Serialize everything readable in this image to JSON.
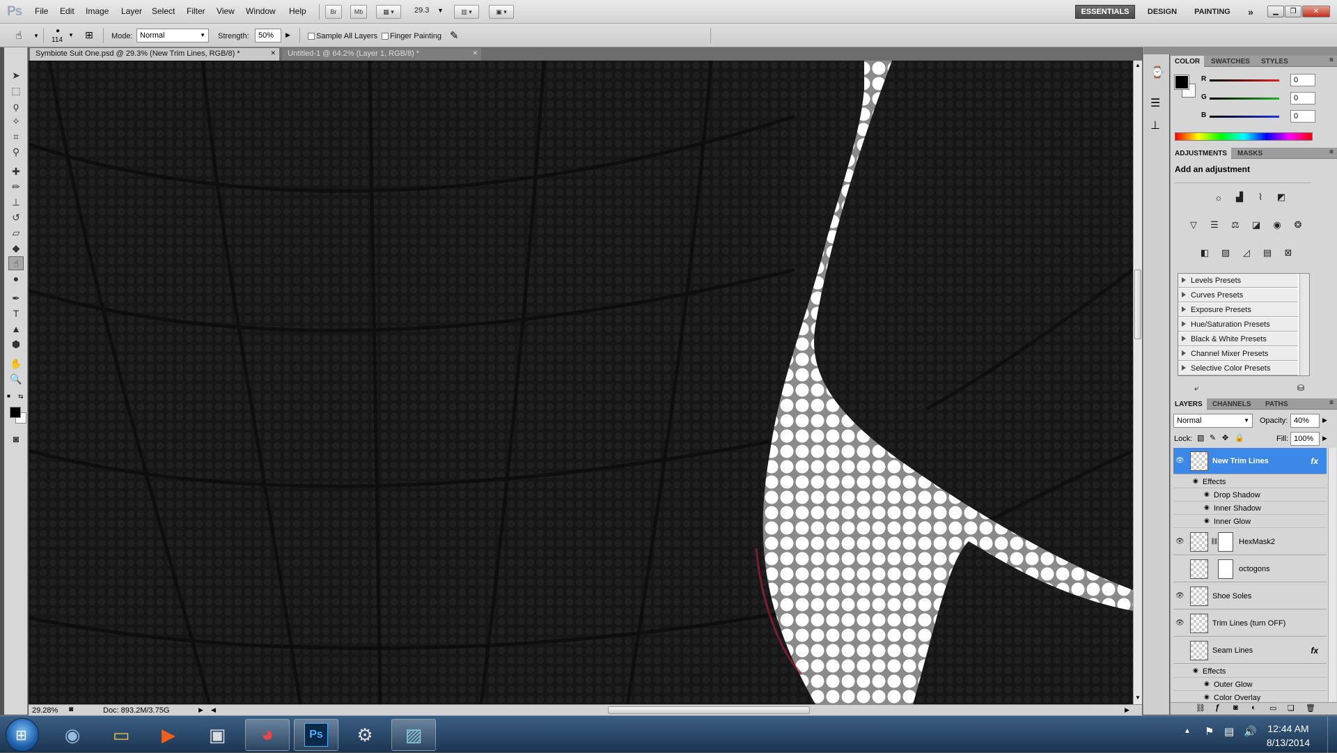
{
  "app": {
    "logo": "Ps",
    "menu": [
      "File",
      "Edit",
      "Image",
      "Layer",
      "Select",
      "Filter",
      "View",
      "Window",
      "Help"
    ],
    "bridge_label": "Br",
    "minibridge_label": "Mb",
    "zoom_value": "29.3",
    "workspaces": [
      "ESSENTIALS",
      "DESIGN",
      "PAINTING"
    ]
  },
  "options": {
    "brush_size": "114",
    "mode_label": "Mode:",
    "mode_value": "Normal",
    "strength_label": "Strength:",
    "strength_value": "50%",
    "sample_all_label": "Sample All Layers",
    "finger_label": "Finger Painting"
  },
  "tabs": [
    {
      "label": "Symbiote Suit One.psd @ 29.3% (New Trim Lines, RGB/8) *",
      "active": true
    },
    {
      "label": "Untitled-1 @ 64.2% (Layer 1, RGB/8) *",
      "active": false
    }
  ],
  "status": {
    "zoom": "29.28%",
    "doc": "Doc: 893.2M/3.75G"
  },
  "color_panel": {
    "tabs": [
      "COLOR",
      "SWATCHES",
      "STYLES"
    ],
    "channels": [
      {
        "label": "R",
        "value": "0",
        "color": "#e02020"
      },
      {
        "label": "G",
        "value": "0",
        "color": "#20b020"
      },
      {
        "label": "B",
        "value": "0",
        "color": "#2030e0"
      }
    ]
  },
  "adjustments": {
    "tabs": [
      "ADJUSTMENTS",
      "MASKS"
    ],
    "heading": "Add an adjustment",
    "presets": [
      "Levels Presets",
      "Curves Presets",
      "Exposure Presets",
      "Hue/Saturation Presets",
      "Black & White Presets",
      "Channel Mixer Presets",
      "Selective Color Presets"
    ]
  },
  "layers_panel": {
    "tabs": [
      "LAYERS",
      "CHANNELS",
      "PATHS"
    ],
    "blend_mode": "Normal",
    "opacity_label": "Opacity:",
    "opacity_value": "40%",
    "lock_label": "Lock:",
    "fill_label": "Fill:",
    "fill_value": "100%",
    "layers": [
      {
        "name": "New Trim Lines",
        "visible": true,
        "selected": true,
        "fx": "fx",
        "effects_label": "Effects",
        "effects": [
          "Drop Shadow",
          "Inner Shadow",
          "Inner Glow"
        ]
      },
      {
        "name": "HexMask2",
        "visible": true,
        "selected": false,
        "has_mask": true
      },
      {
        "name": "octogons",
        "visible": false,
        "selected": false,
        "has_mask": true
      },
      {
        "name": "Shoe Soles",
        "visible": true,
        "selected": false
      },
      {
        "name": "Trim Lines (turn OFF)",
        "visible": true,
        "selected": false
      },
      {
        "name": "Seam Lines",
        "visible": false,
        "selected": false,
        "fx": "fx",
        "effects_label": "Effects",
        "effects": [
          "Outer Glow",
          "Color Overlay"
        ]
      }
    ]
  },
  "taskbar": {
    "time": "12:44 AM",
    "date": "8/13/2014",
    "ps_label": "Ps"
  }
}
